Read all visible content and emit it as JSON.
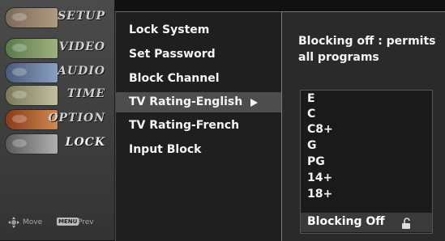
{
  "sidebar": {
    "categories": [
      {
        "label": "SETUP",
        "icon": "setup-icon",
        "color": "#7b6a5a"
      },
      {
        "label": "VIDEO",
        "icon": "video-icon",
        "color": "#6a7a5a"
      },
      {
        "label": "AUDIO",
        "icon": "audio-icon",
        "color": "#5a6a7a"
      },
      {
        "label": "TIME",
        "icon": "time-icon",
        "color": "#7a7a5a"
      },
      {
        "label": "OPTION",
        "icon": "option-icon",
        "color": "#8a5a3a"
      },
      {
        "label": "LOCK",
        "icon": "lock-icon",
        "color": "#6a6a6a"
      }
    ],
    "active": "LOCK",
    "footer": {
      "move_label": "Move",
      "menu_key": "MENU",
      "prev_label": "Prev"
    }
  },
  "menu": {
    "items": [
      {
        "label": "Lock System"
      },
      {
        "label": "Set Password"
      },
      {
        "label": "Block Channel"
      },
      {
        "label": "TV Rating-English",
        "selected": true
      },
      {
        "label": "TV Rating-French"
      },
      {
        "label": "Input Block"
      }
    ]
  },
  "info": {
    "text": "Blocking off : permits all programs",
    "ratings": [
      "E",
      "C",
      "C8+",
      "G",
      "PG",
      "14+",
      "18+"
    ],
    "blocking_option": "Blocking Off",
    "blocking_icon": "unlock-icon"
  },
  "colors": {
    "highlight": "#4d4d4d",
    "text": "#f4f4f4"
  }
}
